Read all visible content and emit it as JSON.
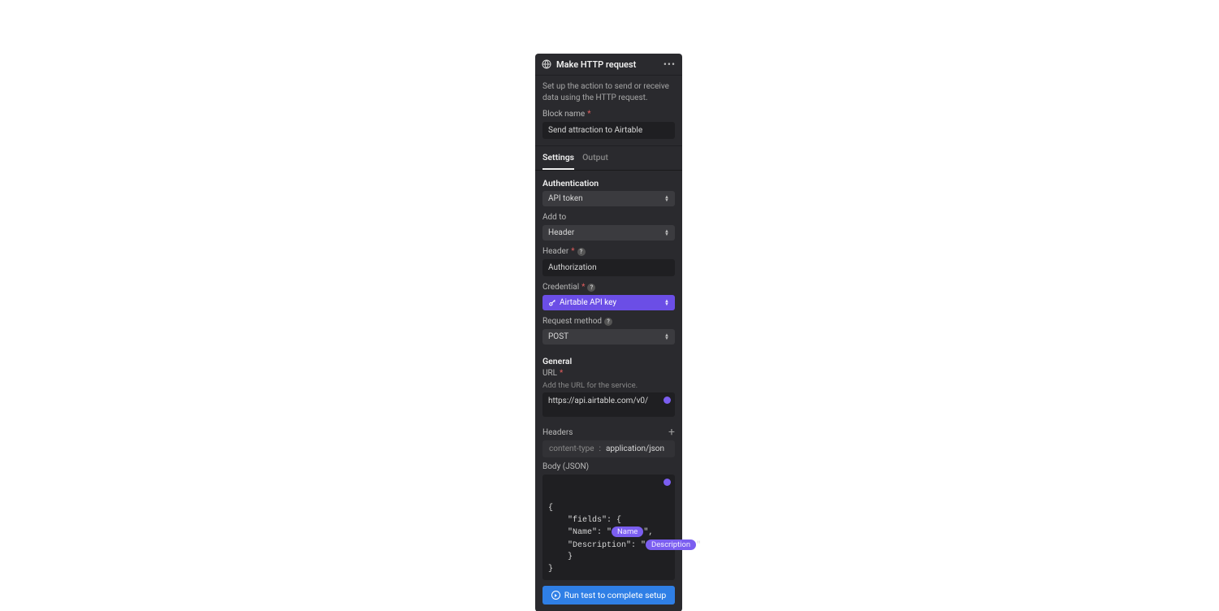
{
  "header": {
    "title": "Make HTTP request"
  },
  "description": "Set up the action to send or receive data using the HTTP request.",
  "blockName": {
    "label": "Block name",
    "value": "Send attraction to Airtable"
  },
  "tabs": {
    "settings": "Settings",
    "output": "Output"
  },
  "auth": {
    "section": "Authentication",
    "value": "API token",
    "addTo": {
      "label": "Add to",
      "value": "Header"
    },
    "header": {
      "label": "Header",
      "value": "Authorization"
    },
    "credential": {
      "label": "Credential",
      "value": "Airtable API key"
    },
    "method": {
      "label": "Request method",
      "value": "POST"
    }
  },
  "general": {
    "section": "General",
    "url": {
      "label": "URL",
      "hint": "Add the URL for the service.",
      "value": "https://api.airtable.com/v0/"
    },
    "headers": {
      "label": "Headers",
      "key": "content-type",
      "value": "application/json"
    },
    "body": {
      "label": "Body (JSON)",
      "line1": "{",
      "line2": "    \"fields\": {",
      "line3a": "    \"Name\": \"",
      "chipName": "Name",
      "line3b": "\",",
      "line4a": "    \"Description\": \"",
      "chipDesc": "Description",
      "line4b": "\"",
      "line5": "    }",
      "line6": "}"
    }
  },
  "run": "Run test to complete setup"
}
